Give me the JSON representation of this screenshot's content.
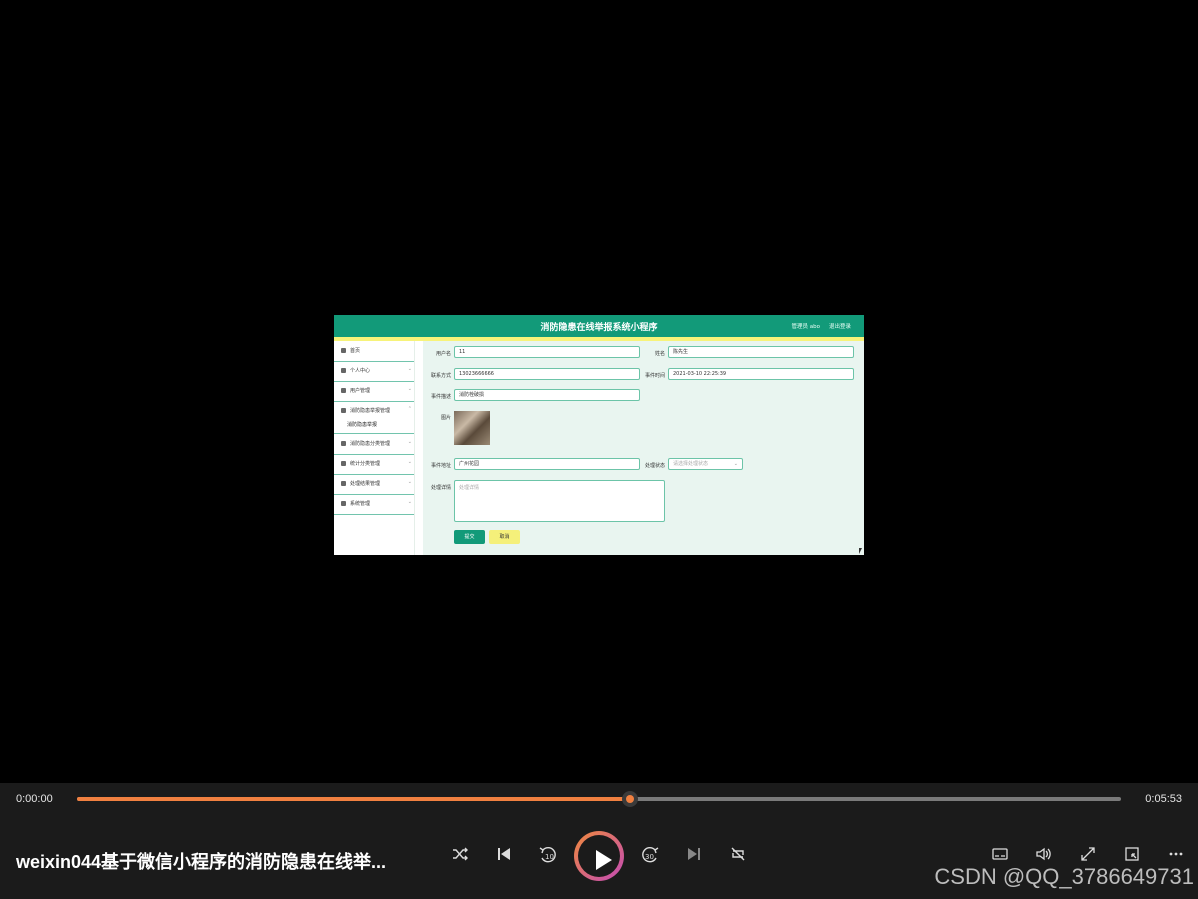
{
  "app": {
    "title": "消防隐患在线举报系统小程序",
    "user": "管理员 abo",
    "logout": "退出登录"
  },
  "sidebar": {
    "items": [
      {
        "label": "首页",
        "icon": "home-icon"
      },
      {
        "label": "个人中心",
        "icon": "user-icon"
      },
      {
        "label": "用户管理",
        "icon": "list-icon"
      },
      {
        "label": "消防隐患举报管理",
        "icon": "send-icon"
      },
      {
        "label": "消防隐患分类管理",
        "icon": "category-icon"
      },
      {
        "label": "统计分类管理",
        "icon": "chart-icon"
      },
      {
        "label": "处理结果管理",
        "icon": "result-icon"
      },
      {
        "label": "系统管理",
        "icon": "flag-icon"
      }
    ],
    "submenu": "消防隐患举报"
  },
  "form": {
    "username_label": "用户名",
    "username": "11",
    "name_label": "姓名",
    "name": "陈先生",
    "phone_label": "联系方式",
    "phone": "13023666666",
    "time_label": "事件时间",
    "time": "2021-03-10 22:25:39",
    "desc_label": "事件描述",
    "desc": "消防栓破损",
    "image_label": "图片",
    "address_label": "事件地址",
    "address": "广州花园",
    "status_label": "处理状态",
    "status_placeholder": "请选择处理状态",
    "detail_label": "处理详情",
    "detail_placeholder": "处理详情",
    "submit": "提交",
    "cancel": "取消"
  },
  "player": {
    "current_time": "0:00:00",
    "total_time": "0:05:53",
    "progress": 0.53,
    "title": "weixin044基于微信小程序的消防隐患在线举...",
    "watermark": "CSDN @QQ_3786649731",
    "accent": "#f08040",
    "controls": [
      "shuffle-icon",
      "previous-icon",
      "rewind-10-icon",
      "play-icon",
      "forward-30-icon",
      "next-icon",
      "repeat-icon",
      "subtitles-icon",
      "volume-icon",
      "fullscreen-icon",
      "mini-player-icon",
      "more-icon"
    ]
  }
}
